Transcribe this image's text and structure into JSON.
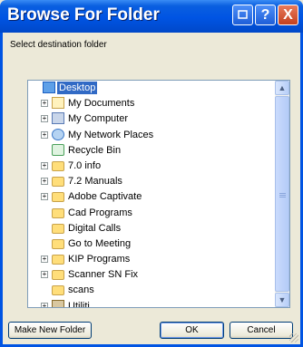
{
  "window": {
    "title": "Browse For Folder",
    "instruction": "Select destination folder"
  },
  "titlebar_buttons": {
    "help_label": "?",
    "close_label": "X"
  },
  "tree": {
    "items": [
      {
        "label": "Desktop",
        "icon": "desktop-icon",
        "expander": "",
        "selected": true
      },
      {
        "label": "My Documents",
        "icon": "my-documents-icon",
        "expander": "+"
      },
      {
        "label": "My Computer",
        "icon": "my-computer-icon",
        "expander": "+"
      },
      {
        "label": "My Network Places",
        "icon": "network-places-icon",
        "expander": "+"
      },
      {
        "label": "Recycle Bin",
        "icon": "recycle-bin-icon",
        "expander": ""
      },
      {
        "label": "7.0 info",
        "icon": "folder-icon",
        "expander": "+"
      },
      {
        "label": "7.2 Manuals",
        "icon": "folder-icon",
        "expander": "+"
      },
      {
        "label": "Adobe Captivate",
        "icon": "folder-icon",
        "expander": "+"
      },
      {
        "label": "Cad Programs",
        "icon": "folder-icon",
        "expander": ""
      },
      {
        "label": "Digital Calls",
        "icon": "folder-icon",
        "expander": ""
      },
      {
        "label": "Go to Meeting",
        "icon": "folder-icon",
        "expander": ""
      },
      {
        "label": "KIP Programs",
        "icon": "folder-icon",
        "expander": "+"
      },
      {
        "label": "Scanner SN Fix",
        "icon": "folder-icon",
        "expander": "+"
      },
      {
        "label": "scans",
        "icon": "folder-icon",
        "expander": ""
      },
      {
        "label": "Utiliti",
        "icon": "utility-folder-icon",
        "expander": "+"
      }
    ]
  },
  "scrollbar": {
    "up_arrow": "▲",
    "down_arrow": "▼"
  },
  "buttons": {
    "make_new_folder": "Make New Folder",
    "ok": "OK",
    "cancel": "Cancel"
  }
}
